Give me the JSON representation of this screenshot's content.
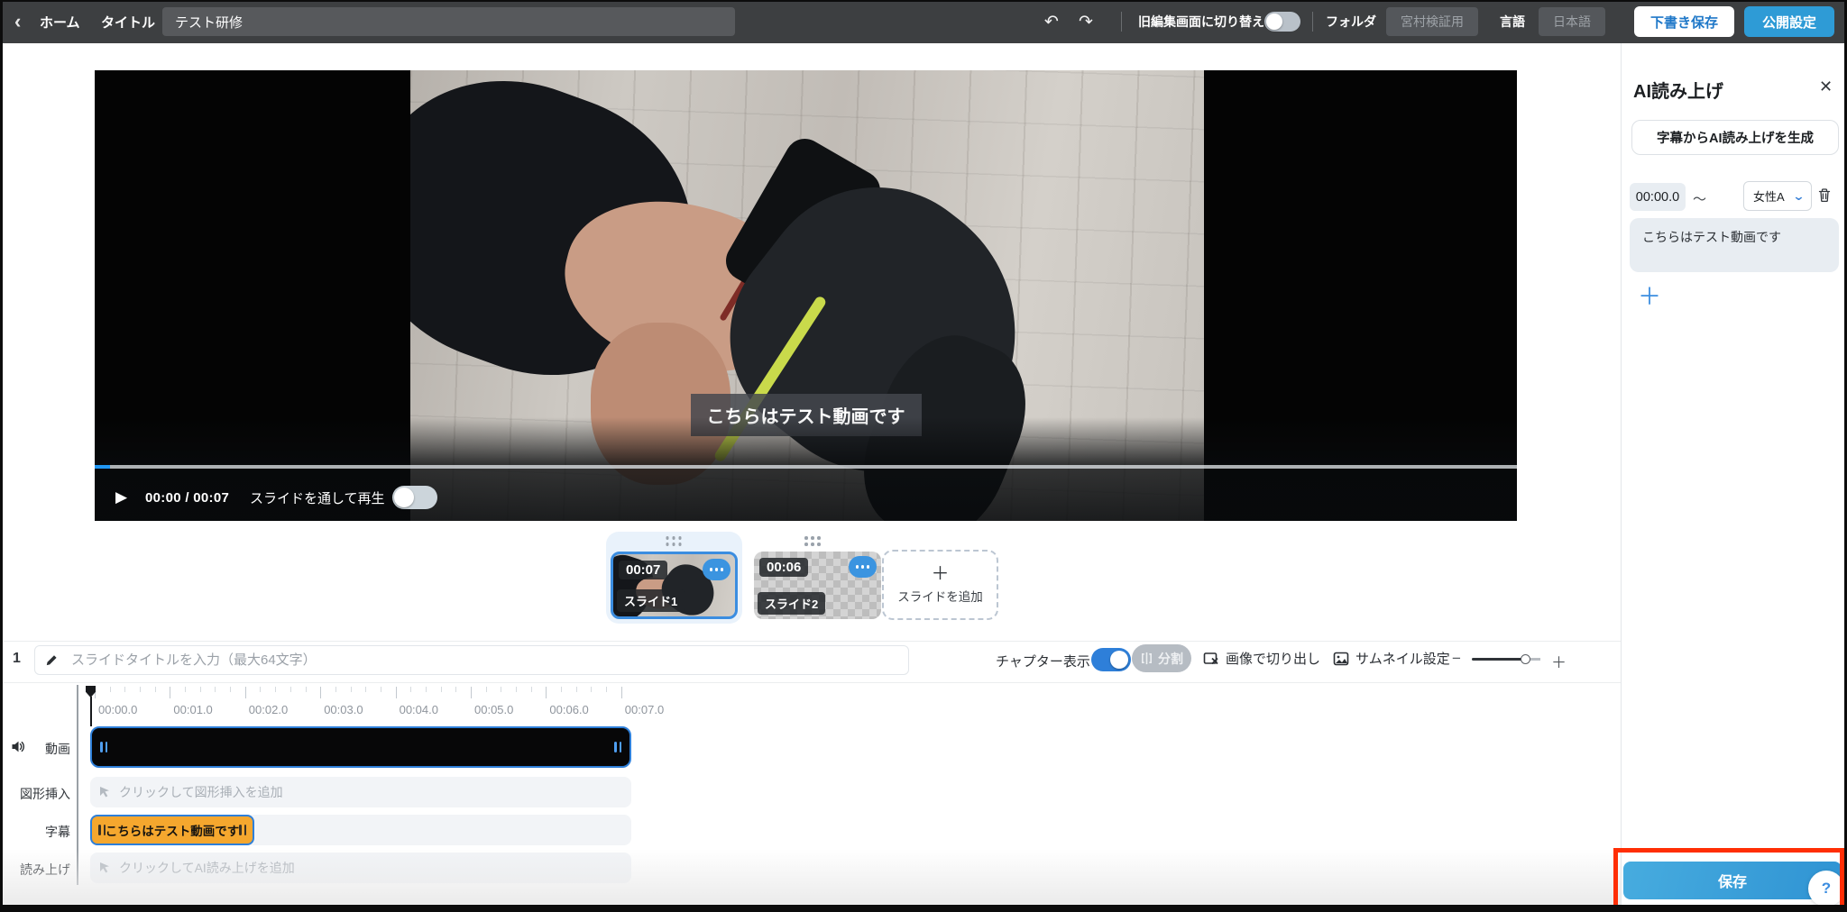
{
  "topbar": {
    "home_label": "ホーム",
    "title_label": "タイトル",
    "title_value": "テスト研修",
    "legacy_toggle_label": "旧編集画面に切り替え",
    "folder_label": "フォルダ",
    "folder_value": "宮村検証用",
    "language_label": "言語",
    "language_value": "日本語",
    "draft_save_label": "下書き保存",
    "publish_label": "公開設定"
  },
  "player": {
    "time_display": "00:00 / 00:07",
    "playthrough_label": "スライドを通して再生",
    "subtitle_overlay": "こちらはテスト動画です"
  },
  "slides": {
    "items": [
      {
        "duration": "00:07",
        "name": "スライド1"
      },
      {
        "duration": "00:06",
        "name": "スライド2"
      }
    ],
    "add_label": "スライドを追加"
  },
  "slide_toolbar": {
    "index": "1",
    "title_placeholder": "スライドタイトルを入力（最大64文字）",
    "chapter_label": "チャプター表示",
    "split_label": "分割",
    "crop_label": "画像で切り出し",
    "thumbnail_label": "サムネイル設定"
  },
  "timeline": {
    "ticks": [
      "00:00.0",
      "00:01.0",
      "00:02.0",
      "00:03.0",
      "00:04.0",
      "00:05.0",
      "00:06.0",
      "00:07.0"
    ],
    "rows": [
      {
        "label": "動画"
      },
      {
        "label": "図形挿入",
        "placeholder": "クリックして図形挿入を追加"
      },
      {
        "label": "字幕",
        "clip_text": "こちらはテスト動画です"
      },
      {
        "label": "読み上げ",
        "placeholder": "クリックしてAI読み上げを追加"
      }
    ]
  },
  "panel": {
    "title": "AI読み上げ",
    "generate_label": "字幕からAI読み上げを生成",
    "segment": {
      "start": "00:00.0",
      "tilde": "～",
      "voice": "女性A",
      "text": "こちらはテスト動画です"
    },
    "save_label": "保存",
    "help_label": "?"
  },
  "icons": {
    "back": "‹",
    "undo": "↶",
    "redo": "↷",
    "play": "▶",
    "close": "✕",
    "plus": "＋",
    "minus": "−",
    "chevron_down": "⌄"
  },
  "colors": {
    "accent_blue": "#2E7FD9",
    "publish_blue": "#2E9BD6",
    "save_blue": "#3AA0DC",
    "subtitle_clip_orange": "#F5A72E",
    "annotation_red": "#FF2E05",
    "topbar_gray": "#3D3F41"
  }
}
